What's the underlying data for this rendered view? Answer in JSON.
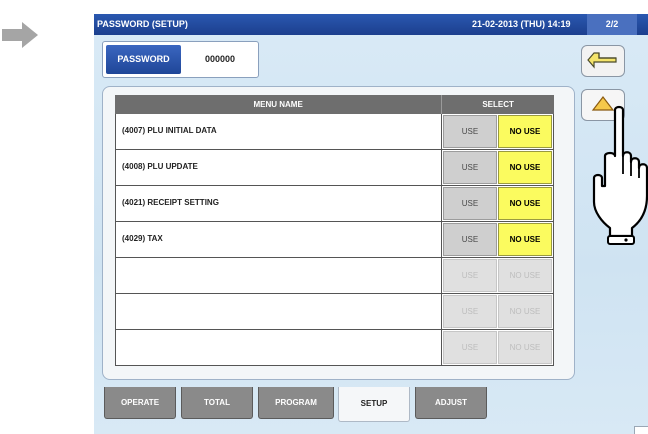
{
  "header": {
    "title": "PASSWORD (SETUP)",
    "datetime": "21-02-2013 (THU) 14:19",
    "page": "2/2"
  },
  "password": {
    "label": "PASSWORD",
    "value": "000000"
  },
  "table": {
    "col_menu": "MENU NAME",
    "col_select": "SELECT",
    "rows": [
      {
        "name": "(4007) PLU INITIAL DATA",
        "use": "USE",
        "no_use": "NO USE"
      },
      {
        "name": "(4008) PLU UPDATE",
        "use": "USE",
        "no_use": "NO USE"
      },
      {
        "name": "(4021) RECEIPT SETTING",
        "use": "USE",
        "no_use": "NO USE"
      },
      {
        "name": "(4029) TAX",
        "use": "USE",
        "no_use": "NO USE"
      },
      {
        "name": "",
        "use": "USE",
        "no_use": "NO USE"
      },
      {
        "name": "",
        "use": "USE",
        "no_use": "NO USE"
      },
      {
        "name": "",
        "use": "USE",
        "no_use": "NO USE"
      }
    ]
  },
  "tabs": [
    "OPERATE",
    "TOTAL",
    "PROGRAM",
    "SETUP",
    "ADJUST"
  ],
  "active_tab": "SETUP",
  "icons": {
    "left_arrow": "right-arrow-icon",
    "return": "return-arrow-icon",
    "page_up": "triangle-up-icon",
    "pointer": "pointing-hand-icon"
  },
  "colors": {
    "title_bar": "#1c3f8e",
    "no_use_selected": "#fbfb5f",
    "use_button": "#cfcfcf",
    "tab": "#8a8a8a"
  }
}
